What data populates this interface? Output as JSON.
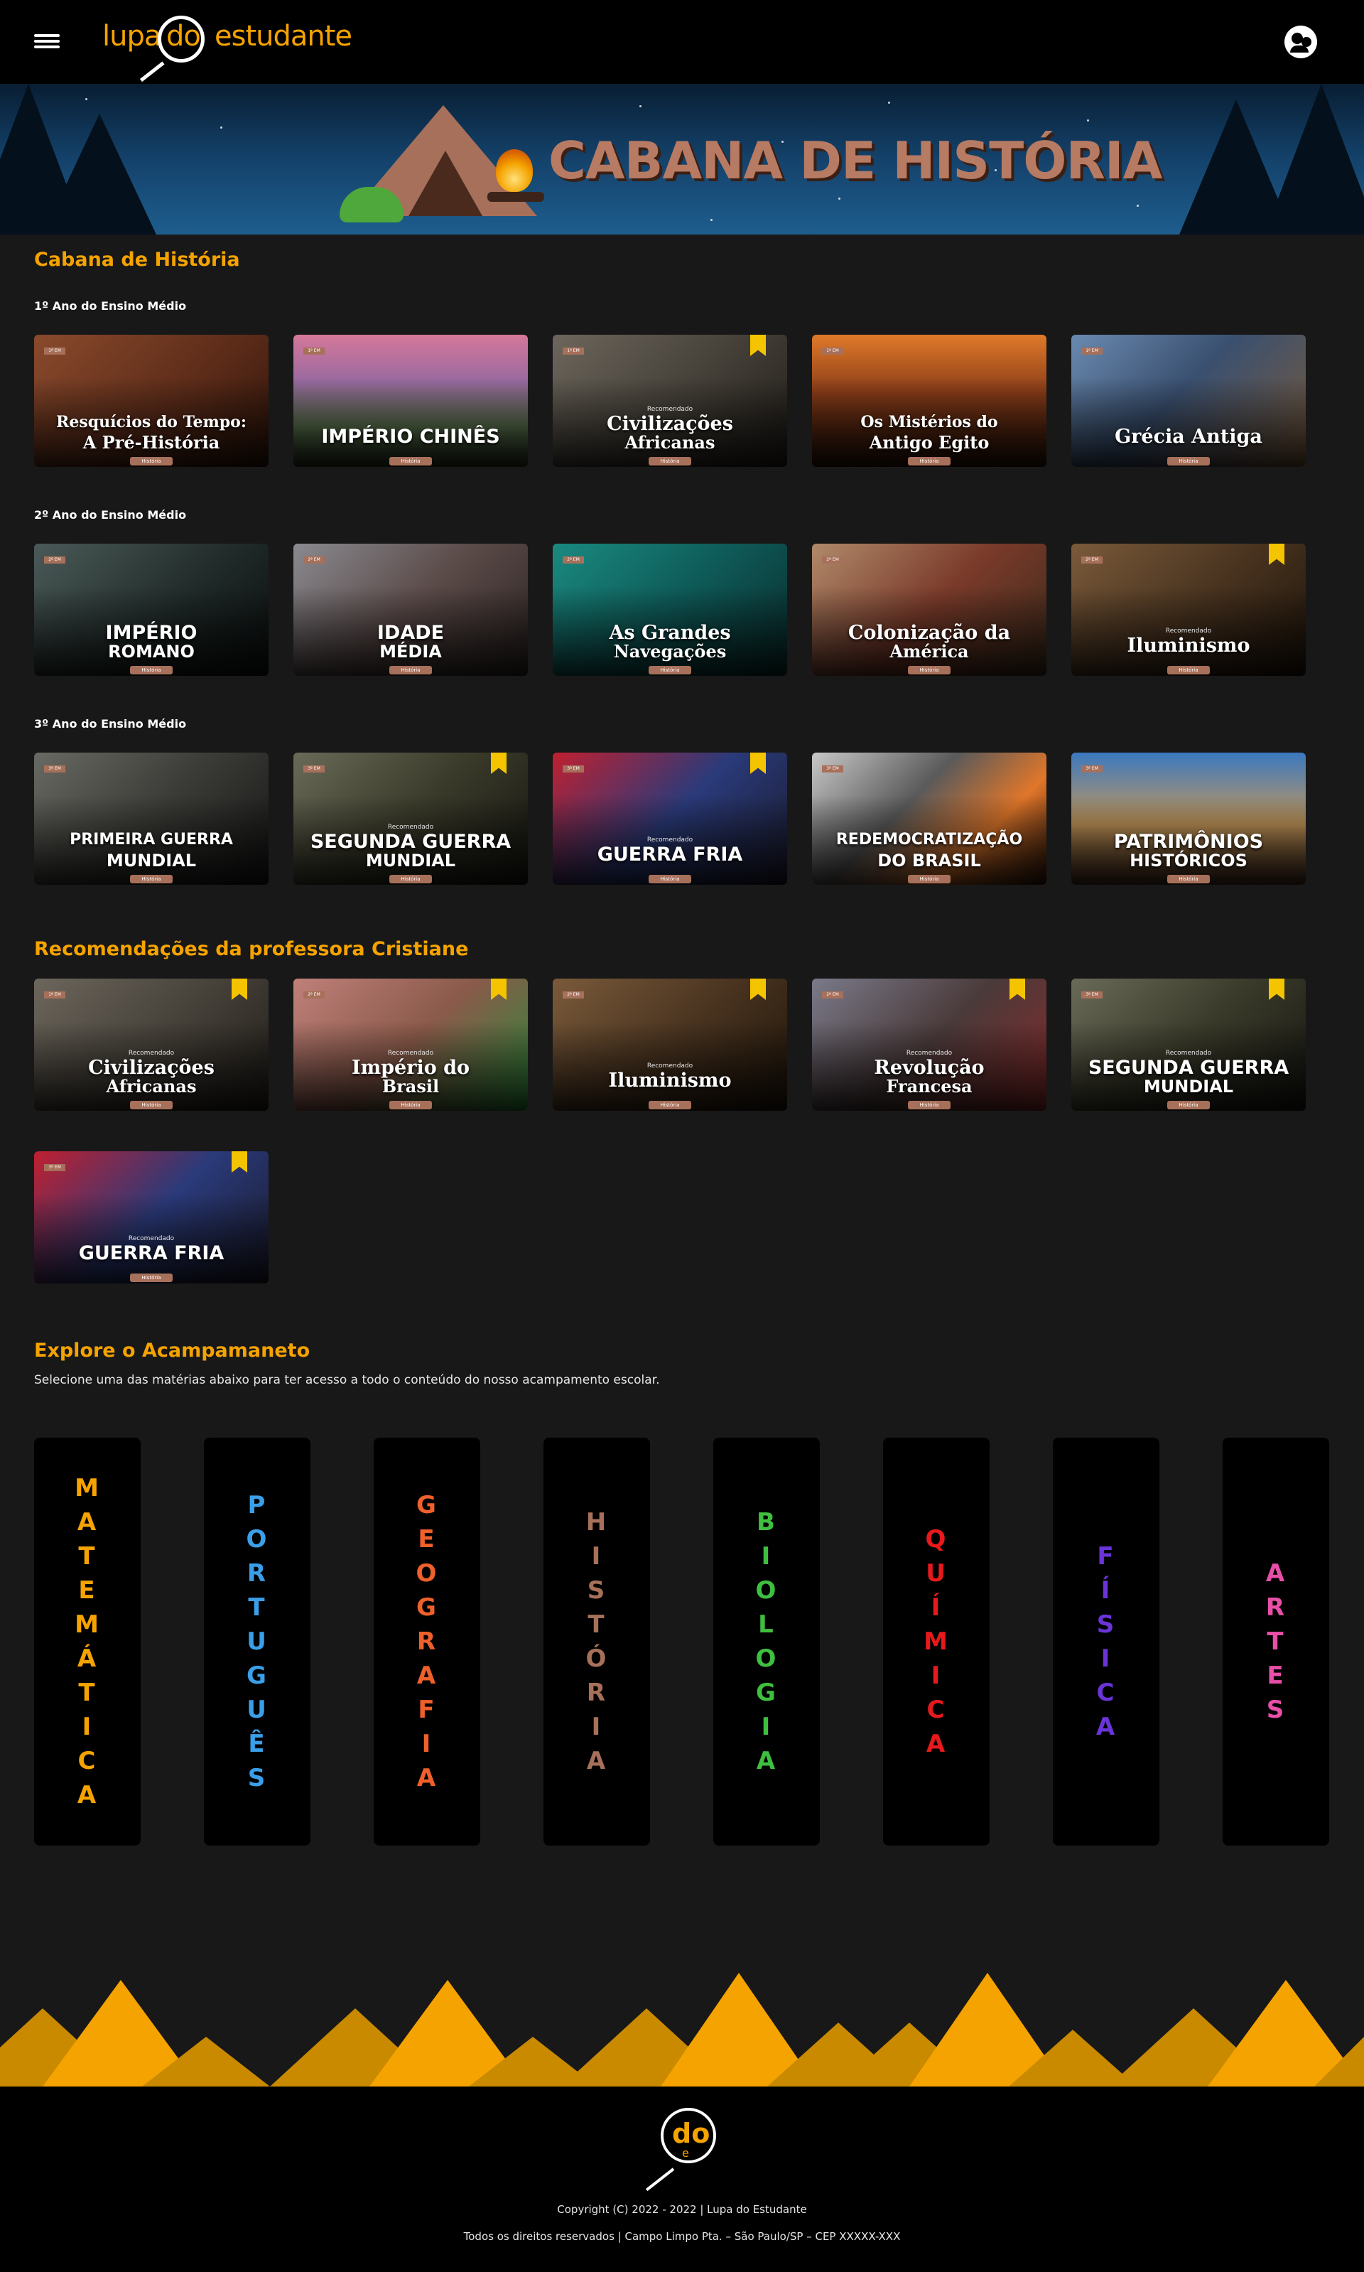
{
  "header": {
    "menu_icon": "hamburger-icon",
    "logo": {
      "part1": "lupa",
      "part2": "do",
      "part3": "estudante"
    },
    "profile_icon": "user-circle-icon"
  },
  "banner": {
    "title": "CABANA DE HISTÓRIA",
    "accent": "#b77a63"
  },
  "history_section": {
    "title": "Cabana de História",
    "rows": [
      {
        "heading": "1º Ano do Ensino Médio",
        "cards": [
          {
            "title": "Resquícios do Tempo:",
            "subtitle": "A Pré-História",
            "grade": "1º EM",
            "subject": "História",
            "bookmarked": false,
            "recommended": ""
          },
          {
            "title": "IMPÉRIO CHINÊS",
            "subtitle": "",
            "grade": "1º EM",
            "subject": "História",
            "bookmarked": false,
            "recommended": ""
          },
          {
            "title": "Civilizações",
            "subtitle": "Africanas",
            "grade": "1º EM",
            "subject": "História",
            "bookmarked": true,
            "recommended": "Recomendado"
          },
          {
            "title": "Os Mistérios do",
            "subtitle": "Antigo Egito",
            "grade": "1º EM",
            "subject": "História",
            "bookmarked": false,
            "recommended": ""
          },
          {
            "title": "Grécia Antiga",
            "subtitle": "",
            "grade": "1º EM",
            "subject": "História",
            "bookmarked": false,
            "recommended": ""
          }
        ]
      },
      {
        "heading": "2º Ano do Ensino Médio",
        "cards": [
          {
            "title": "IMPÉRIO",
            "subtitle": "ROMANO",
            "grade": "2º EM",
            "subject": "História",
            "bookmarked": false,
            "recommended": ""
          },
          {
            "title": "IDADE",
            "subtitle": "MÉDIA",
            "grade": "2º EM",
            "subject": "História",
            "bookmarked": false,
            "recommended": ""
          },
          {
            "title": "As Grandes",
            "subtitle": "Navegações",
            "grade": "2º EM",
            "subject": "História",
            "bookmarked": false,
            "recommended": ""
          },
          {
            "title": "Colonização da",
            "subtitle": "América",
            "grade": "2º EM",
            "subject": "História",
            "bookmarked": false,
            "recommended": ""
          },
          {
            "title": "Iluminismo",
            "subtitle": "",
            "grade": "2º EM",
            "subject": "História",
            "bookmarked": true,
            "recommended": "Recomendado"
          }
        ]
      },
      {
        "heading": "3º Ano do Ensino Médio",
        "cards": [
          {
            "title": "PRIMEIRA GUERRA",
            "subtitle": "MUNDIAL",
            "grade": "3º EM",
            "subject": "História",
            "bookmarked": false,
            "recommended": ""
          },
          {
            "title": "SEGUNDA GUERRA",
            "subtitle": "MUNDIAL",
            "grade": "3º EM",
            "subject": "História",
            "bookmarked": true,
            "recommended": "Recomendado"
          },
          {
            "title": "GUERRA FRIA",
            "subtitle": "",
            "grade": "3º EM",
            "subject": "História",
            "bookmarked": true,
            "recommended": "Recomendado"
          },
          {
            "title": "REDEMOCRATIZAÇÃO",
            "subtitle": "DO BRASIL",
            "grade": "3º EM",
            "subject": "História",
            "bookmarked": false,
            "recommended": ""
          },
          {
            "title": "PATRIMÔNIOS",
            "subtitle": "HISTÓRICOS",
            "grade": "3º EM",
            "subject": "História",
            "bookmarked": false,
            "recommended": ""
          }
        ]
      }
    ]
  },
  "recommendations": {
    "title": "Recomendações da professora Cristiane",
    "cards": [
      {
        "title": "Civilizações",
        "subtitle": "Africanas",
        "grade": "1º EM",
        "subject": "História",
        "bookmarked": true,
        "recommended": "Recomendado"
      },
      {
        "title": "Império do",
        "subtitle": "Brasil",
        "grade": "2º EM",
        "subject": "História",
        "bookmarked": true,
        "recommended": "Recomendado"
      },
      {
        "title": "Iluminismo",
        "subtitle": "",
        "grade": "2º EM",
        "subject": "História",
        "bookmarked": true,
        "recommended": "Recomendado"
      },
      {
        "title": "Revolução",
        "subtitle": "Francesa",
        "grade": "2º EM",
        "subject": "História",
        "bookmarked": true,
        "recommended": "Recomendado"
      },
      {
        "title": "SEGUNDA GUERRA",
        "subtitle": "MUNDIAL",
        "grade": "3º EM",
        "subject": "História",
        "bookmarked": true,
        "recommended": "Recomendado"
      },
      {
        "title": "GUERRA FRIA",
        "subtitle": "",
        "grade": "3º EM",
        "subject": "História",
        "bookmarked": true,
        "recommended": "Recomendado"
      }
    ]
  },
  "explore": {
    "title": "Explore o Acampamaneto",
    "description": "Selecione uma das matérias abaixo para ter acesso a todo o conteúdo do nosso acampamento escolar.",
    "subjects": [
      {
        "label": "MATEMÁTICA",
        "color": "#f5a300"
      },
      {
        "label": "PORTUGUÊS",
        "color": "#3a9fe8"
      },
      {
        "label": "GEOGRAFIA",
        "color": "#f0602b"
      },
      {
        "label": "HISTÓRIA",
        "color": "#a7705a"
      },
      {
        "label": "BIOLOGIA",
        "color": "#3fbf3f"
      },
      {
        "label": "QUÍMICA",
        "color": "#e8191c"
      },
      {
        "label": "FÍSICA",
        "color": "#6a34d8"
      },
      {
        "label": "ARTES",
        "color": "#e84fa8"
      }
    ]
  },
  "footer": {
    "logo": {
      "part1": "do",
      "part2": "e"
    },
    "copyright": "Copyright (C) 2022 - 2022 | Lupa do Estudante",
    "rights": "Todos os direitos reservados | Campo Limpo Pta. – São Paulo/SP – CEP XXXXX-XXX"
  },
  "colors": {
    "accent": "#f5a300",
    "background": "#181818"
  }
}
